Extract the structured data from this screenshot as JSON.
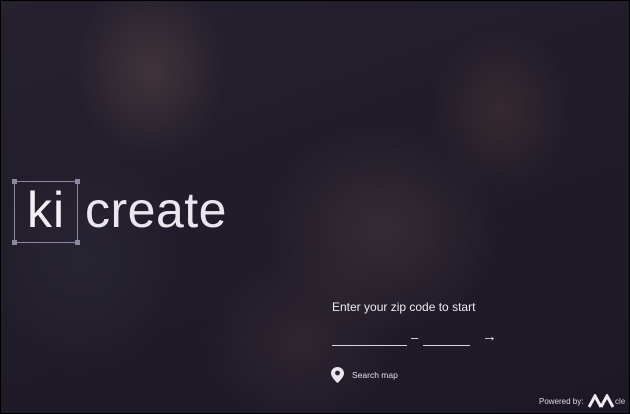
{
  "logo": {
    "ki": "ki",
    "create": "create"
  },
  "zip_form": {
    "label": "Enter your zip code to start",
    "zip_placeholder": "",
    "zip4_placeholder": "",
    "dash": "–",
    "submit_symbol": "→"
  },
  "search_map": {
    "label": "Search map",
    "icon": "map-pin-icon"
  },
  "footer": {
    "powered_by": "Powered by:",
    "brand_text": "cle"
  },
  "colors": {
    "overlay": "#1c1628",
    "text": "#eceaf0",
    "logo_frame": "#8d87a3"
  }
}
